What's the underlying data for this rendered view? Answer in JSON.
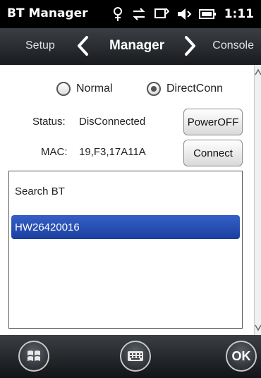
{
  "statusbar": {
    "title": "BT Manager",
    "time": "1:11",
    "icons": [
      "connection-icon",
      "data-sync-icon",
      "message-icon",
      "volume-icon",
      "battery-icon"
    ]
  },
  "navbar": {
    "left": "Setup",
    "center": "Manager",
    "right": "Console"
  },
  "mode": {
    "options": [
      "Normal",
      "DirectConn"
    ],
    "selected": "DirectConn"
  },
  "info": {
    "status_label": "Status:",
    "status_value": "DisConnected",
    "mac_label": "MAC:",
    "mac_value": "19,F3,17A11A"
  },
  "buttons": {
    "power": "PowerOFF",
    "connect": "Connect"
  },
  "list": {
    "header": "Search BT",
    "items": [
      "HW26420016"
    ],
    "selected_index": 0
  },
  "softkeys": {
    "ok": "OK"
  },
  "colors": {
    "selection": "#1c3fa0",
    "chrome": "#2b2e32"
  }
}
